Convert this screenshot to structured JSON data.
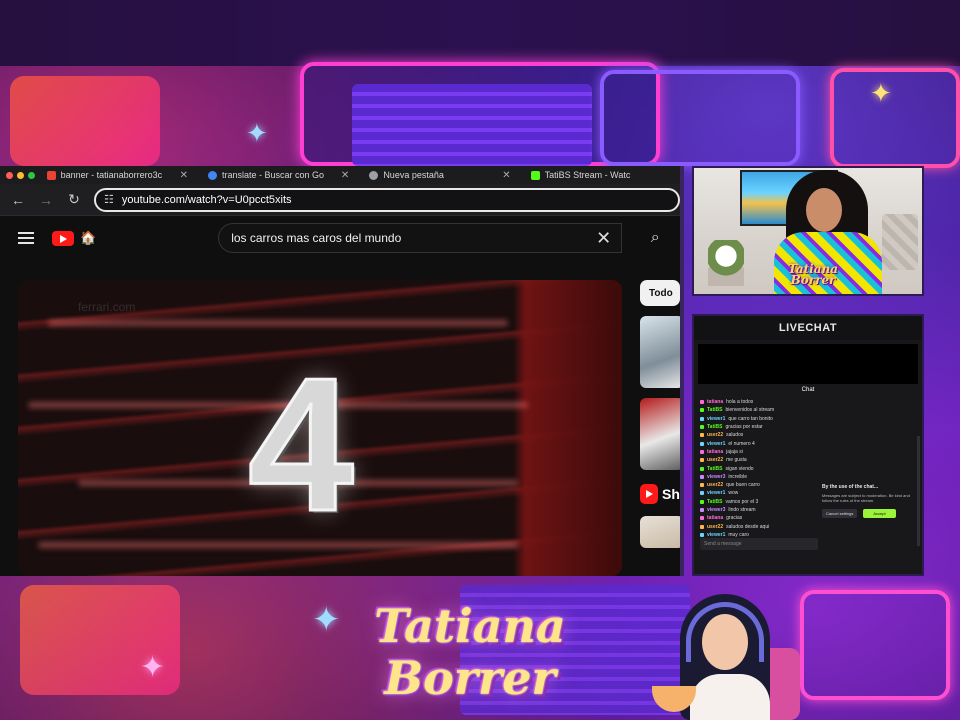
{
  "browser": {
    "tabs": [
      {
        "label": "banner - tatianaborrero3c",
        "favicon_color": "#ea4335"
      },
      {
        "label": "translate - Buscar con Go",
        "favicon_color": "#4285f4"
      },
      {
        "label": "Nueva pestaña",
        "favicon_color": "#9aa0a6"
      },
      {
        "label": "TatiBS Stream - Watc",
        "favicon_color": "#53fc18"
      }
    ],
    "tab_close_glyph": "✕",
    "url": "youtube.com/watch?v=U0pcct5xits"
  },
  "youtube": {
    "search_query": "los carros mas caros del mundo",
    "video_number": "4",
    "video_watermark": "ferrari.com",
    "chip_label": "Todo",
    "shorts_label": "Sh"
  },
  "livechat": {
    "title": "LIVECHAT",
    "chat_label": "Chat",
    "messages": [
      {
        "name": "tatiana",
        "text": "hola a todos",
        "color": "#ff6bd6"
      },
      {
        "name": "TatiBS",
        "text": "bienvenidos al stream",
        "color": "#53fc18"
      },
      {
        "name": "viewer1",
        "text": "que carro tan bonito",
        "color": "#6bd3ff"
      },
      {
        "name": "TatiBS",
        "text": "gracias por estar",
        "color": "#53fc18"
      },
      {
        "name": "user22",
        "text": "saludos",
        "color": "#ffb84d"
      },
      {
        "name": "viewer1",
        "text": "el numero 4",
        "color": "#6bd3ff"
      },
      {
        "name": "tatiana",
        "text": "jajaja si",
        "color": "#ff6bd6"
      },
      {
        "name": "user22",
        "text": "me gusta",
        "color": "#ffb84d"
      },
      {
        "name": "TatiBS",
        "text": "sigan viendo",
        "color": "#53fc18"
      },
      {
        "name": "viewer3",
        "text": "increible",
        "color": "#c58bff"
      },
      {
        "name": "user22",
        "text": "que buen carro",
        "color": "#ffb84d"
      },
      {
        "name": "viewer1",
        "text": "wow",
        "color": "#6bd3ff"
      },
      {
        "name": "TatiBS",
        "text": "vamos por el 3",
        "color": "#53fc18"
      },
      {
        "name": "viewer3",
        "text": "lindo stream",
        "color": "#c58bff"
      },
      {
        "name": "tatiana",
        "text": "gracias",
        "color": "#ff6bd6"
      },
      {
        "name": "user22",
        "text": "saludos desde aqui",
        "color": "#ffb84d"
      },
      {
        "name": "viewer1",
        "text": "muy caro",
        "color": "#6bd3ff"
      }
    ],
    "popup_title": "By the use of the chat...",
    "popup_body": "Messages are subject to moderation. Be kind and follow the rules of the stream.",
    "popup_cancel": "Cancel settings",
    "popup_accept": "Accept",
    "input_placeholder": "Send a message"
  },
  "webcam": {
    "logo_line1": "Tatiana",
    "logo_line2": "Borrer"
  },
  "banner": {
    "line1": "Tatiana",
    "line2": "Borrer"
  }
}
